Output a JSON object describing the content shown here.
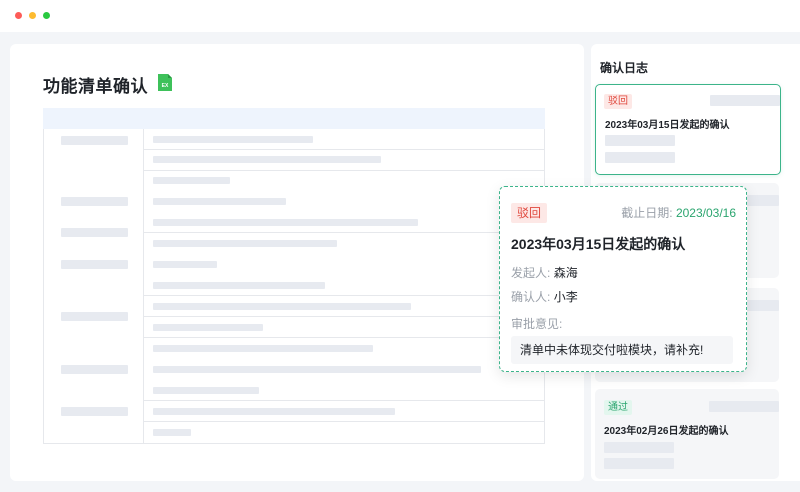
{
  "window": {
    "controls": [
      "close",
      "minimize",
      "maximize"
    ]
  },
  "document": {
    "title": "功能清单确认",
    "file_icon": {
      "name": "excel-file-icon",
      "label": "EX",
      "color": "#3ec15a"
    }
  },
  "log": {
    "title": "确认日志",
    "cards": [
      {
        "status": "驳回",
        "title": "2023年03月15日发起的确认",
        "selected": true
      },
      {
        "status": "",
        "title": "",
        "selected": false
      },
      {
        "status": "",
        "title": "",
        "selected": false
      },
      {
        "status": "通过",
        "title": "2023年02月26日发起的确认",
        "selected": false
      }
    ]
  },
  "popover": {
    "status": "驳回",
    "deadline_label": "截止日期:",
    "deadline_value": "2023/03/16",
    "title": "2023年03月15日发起的确认",
    "initiator_label": "发起人:",
    "initiator": "森海",
    "confirmer_label": "确认人:",
    "confirmer": "小李",
    "opinion_label": "审批意见:",
    "opinion": "清单中未体现交付啦模块，请补充!"
  },
  "colors": {
    "accent": "#3cb48a",
    "reject": "#e0483d",
    "pass": "#2ba56f",
    "table_header": "#eef4fd"
  }
}
